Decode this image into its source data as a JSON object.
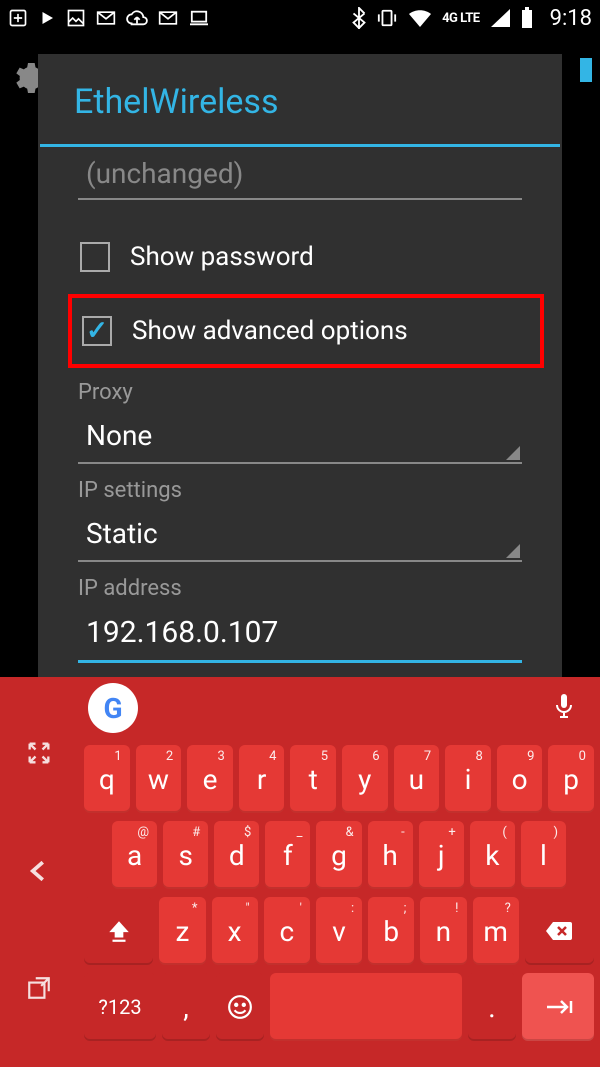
{
  "status": {
    "clock": "9:18",
    "lte": "4G LTE"
  },
  "dialog": {
    "title": "EthelWireless",
    "prev_field_value": "(unchanged)",
    "show_password": {
      "label": "Show password",
      "checked": false
    },
    "show_advanced": {
      "label": "Show advanced options",
      "checked": true
    },
    "proxy": {
      "label": "Proxy",
      "value": "None"
    },
    "ip_settings": {
      "label": "IP settings",
      "value": "Static"
    },
    "ip_address": {
      "label": "IP address",
      "value": "192.168.0.107"
    }
  },
  "keyboard": {
    "symbols_key": "?123",
    "row1": [
      {
        "k": "q",
        "s": "1"
      },
      {
        "k": "w",
        "s": "2"
      },
      {
        "k": "e",
        "s": "3"
      },
      {
        "k": "r",
        "s": "4"
      },
      {
        "k": "t",
        "s": "5"
      },
      {
        "k": "y",
        "s": "6"
      },
      {
        "k": "u",
        "s": "7"
      },
      {
        "k": "i",
        "s": "8"
      },
      {
        "k": "o",
        "s": "9"
      },
      {
        "k": "p",
        "s": "0"
      }
    ],
    "row2": [
      {
        "k": "a",
        "s": "@"
      },
      {
        "k": "s",
        "s": "#"
      },
      {
        "k": "d",
        "s": "$"
      },
      {
        "k": "f",
        "s": "_"
      },
      {
        "k": "g",
        "s": "&"
      },
      {
        "k": "h",
        "s": "-"
      },
      {
        "k": "j",
        "s": "+"
      },
      {
        "k": "k",
        "s": "("
      },
      {
        "k": "l",
        "s": ")"
      }
    ],
    "row3": [
      {
        "k": "z",
        "s": "*"
      },
      {
        "k": "x",
        "s": "\""
      },
      {
        "k": "c",
        "s": "'"
      },
      {
        "k": "v",
        "s": ":"
      },
      {
        "k": "b",
        "s": ";"
      },
      {
        "k": "n",
        "s": "!"
      },
      {
        "k": "m",
        "s": "?"
      }
    ]
  }
}
